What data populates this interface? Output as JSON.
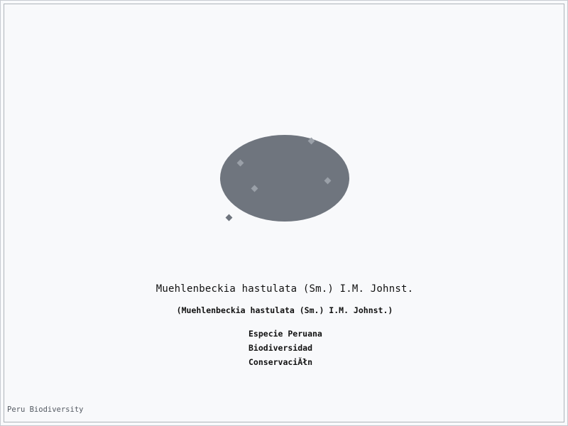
{
  "title": "Muehlenbeckia hastulata (Sm.) I.M. Johnst.",
  "subtitle": "(Muehlenbeckia hastulata (Sm.) I.M. Johnst.)",
  "tags": [
    "Especie Peruana",
    "Biodiversidad",
    "ConservaciĂłn"
  ],
  "footer": "Peru Biodiversity",
  "colors": {
    "shape_fill": "#6f757e",
    "dot_fill": "#9aa0a8",
    "background": "#f8f9fb",
    "frame": "#aeb3ba"
  }
}
